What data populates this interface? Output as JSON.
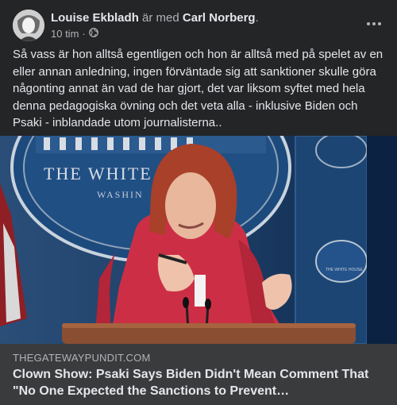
{
  "post": {
    "author": "Louise Ekbladh",
    "with_text": "är med",
    "tagged": "Carl Norberg",
    "period": ".",
    "time": "10 tim",
    "dot": "·",
    "text": "Så vass är hon alltså egentligen och hon är alltså med på spelet av en eller annan anledning, ingen förväntade sig att sanktioner skulle göra någonting annat än vad de har gjort, det var liksom syftet med hela denna pedagogiska övning och det veta alla - inklusive Biden och Psaki - inblandade utom journalisterna..",
    "audience_icon": "globe-icon",
    "more_icon": "more-options-icon"
  },
  "image": {
    "seal_text_1": "THE WHITE",
    "seal_text_2": "WASHIN",
    "small_seal_text": "THE WHITE HOUSE"
  },
  "link": {
    "domain": "THEGATEWAYPUNDIT.COM",
    "title": "Clown Show: Psaki Says Biden Didn't Mean Comment That \"No One Expected the Sanctions to Prevent…"
  },
  "colors": {
    "card_bg": "#242526",
    "link_bg": "#3a3b3c",
    "text_primary": "#e4e6eb",
    "text_secondary": "#b0b3b8"
  }
}
